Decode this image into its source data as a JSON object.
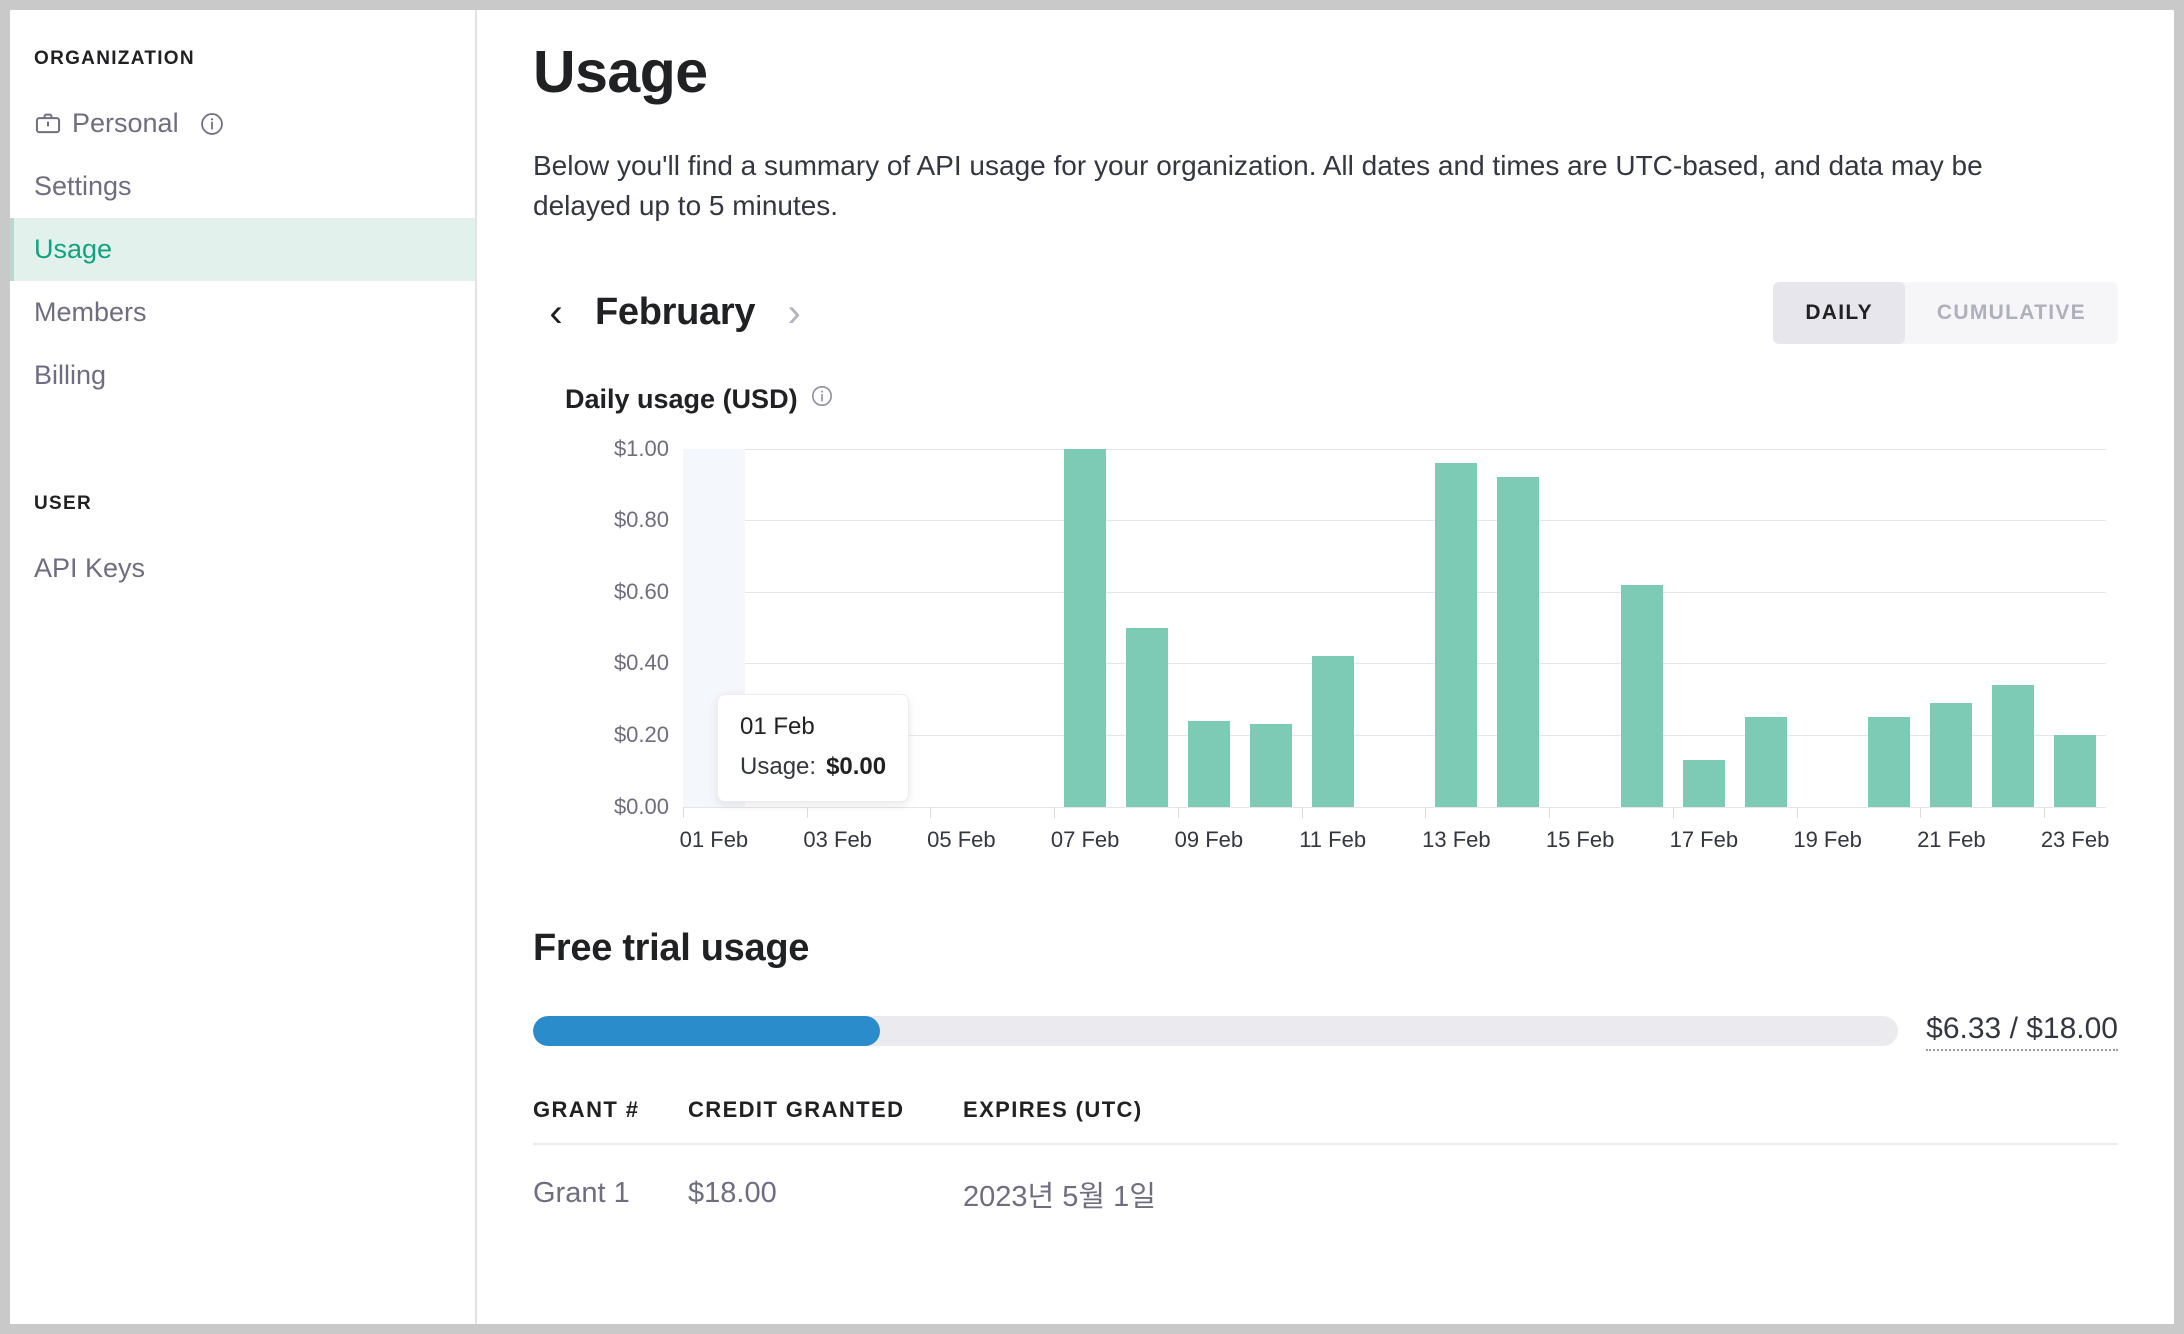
{
  "sidebar": {
    "org_label": "ORGANIZATION",
    "user_label": "USER",
    "org_items": [
      {
        "label": "Personal",
        "icon": "briefcase-icon",
        "info_icon": "info-icon",
        "active": false
      },
      {
        "label": "Settings",
        "active": false
      },
      {
        "label": "Usage",
        "active": true
      },
      {
        "label": "Members",
        "active": false
      },
      {
        "label": "Billing",
        "active": false
      }
    ],
    "user_items": [
      {
        "label": "API Keys",
        "active": false
      }
    ]
  },
  "main": {
    "title": "Usage",
    "intro": "Below you'll find a summary of API usage for your organization. All dates and times are UTC-based, and data may be delayed up to 5 minutes.",
    "month": "February",
    "prev_icon": "chevron-left-icon",
    "next_icon": "chevron-right-icon",
    "toggle": {
      "daily": "DAILY",
      "cumulative": "CUMULATIVE",
      "selected": "DAILY"
    },
    "chart_title": "Daily usage (USD)",
    "chart_info_icon": "info-icon",
    "tooltip": {
      "date": "01 Feb",
      "label": "Usage:",
      "value": "$0.00"
    }
  },
  "free_trial": {
    "title": "Free trial usage",
    "used": "$6.33",
    "total": "$18.00",
    "amount_text": "$6.33 / $18.00",
    "percent": 25.4,
    "bar_color": "#2b8ccc",
    "track_color": "#ebebef",
    "table": {
      "headers": [
        "GRANT #",
        "CREDIT GRANTED",
        "EXPIRES (UTC)"
      ],
      "rows": [
        [
          "Grant 1",
          "$18.00",
          "2023년 5월 1일"
        ]
      ]
    }
  },
  "chart_data": {
    "type": "bar",
    "title": "Daily usage (USD)",
    "xlabel": "",
    "ylabel": "USD",
    "ylim": [
      0,
      1.0
    ],
    "ytick_labels": [
      "$0.00",
      "$0.20",
      "$0.40",
      "$0.60",
      "$0.80",
      "$1.00"
    ],
    "ytick_values": [
      0,
      0.2,
      0.4,
      0.6,
      0.8,
      1.0
    ],
    "xtick_labels": [
      "01 Feb",
      "03 Feb",
      "05 Feb",
      "07 Feb",
      "09 Feb",
      "11 Feb",
      "13 Feb",
      "15 Feb",
      "17 Feb",
      "19 Feb",
      "21 Feb",
      "23 Feb"
    ],
    "grid": true,
    "legend": false,
    "bar_color": "#7ecbb5",
    "hover_index": 0,
    "categories": [
      "01 Feb",
      "02 Feb",
      "03 Feb",
      "04 Feb",
      "05 Feb",
      "06 Feb",
      "07 Feb",
      "08 Feb",
      "09 Feb",
      "10 Feb",
      "11 Feb",
      "12 Feb",
      "13 Feb",
      "14 Feb",
      "15 Feb",
      "16 Feb",
      "17 Feb",
      "18 Feb",
      "19 Feb",
      "20 Feb",
      "21 Feb",
      "22 Feb",
      "23 Feb"
    ],
    "values": [
      0,
      0,
      0,
      0,
      0,
      0,
      1.0,
      0.5,
      0.24,
      0.23,
      0.42,
      0,
      0.96,
      0.92,
      0,
      0.62,
      0.13,
      0.25,
      0,
      0.25,
      0.29,
      0.34,
      0.2
    ]
  }
}
